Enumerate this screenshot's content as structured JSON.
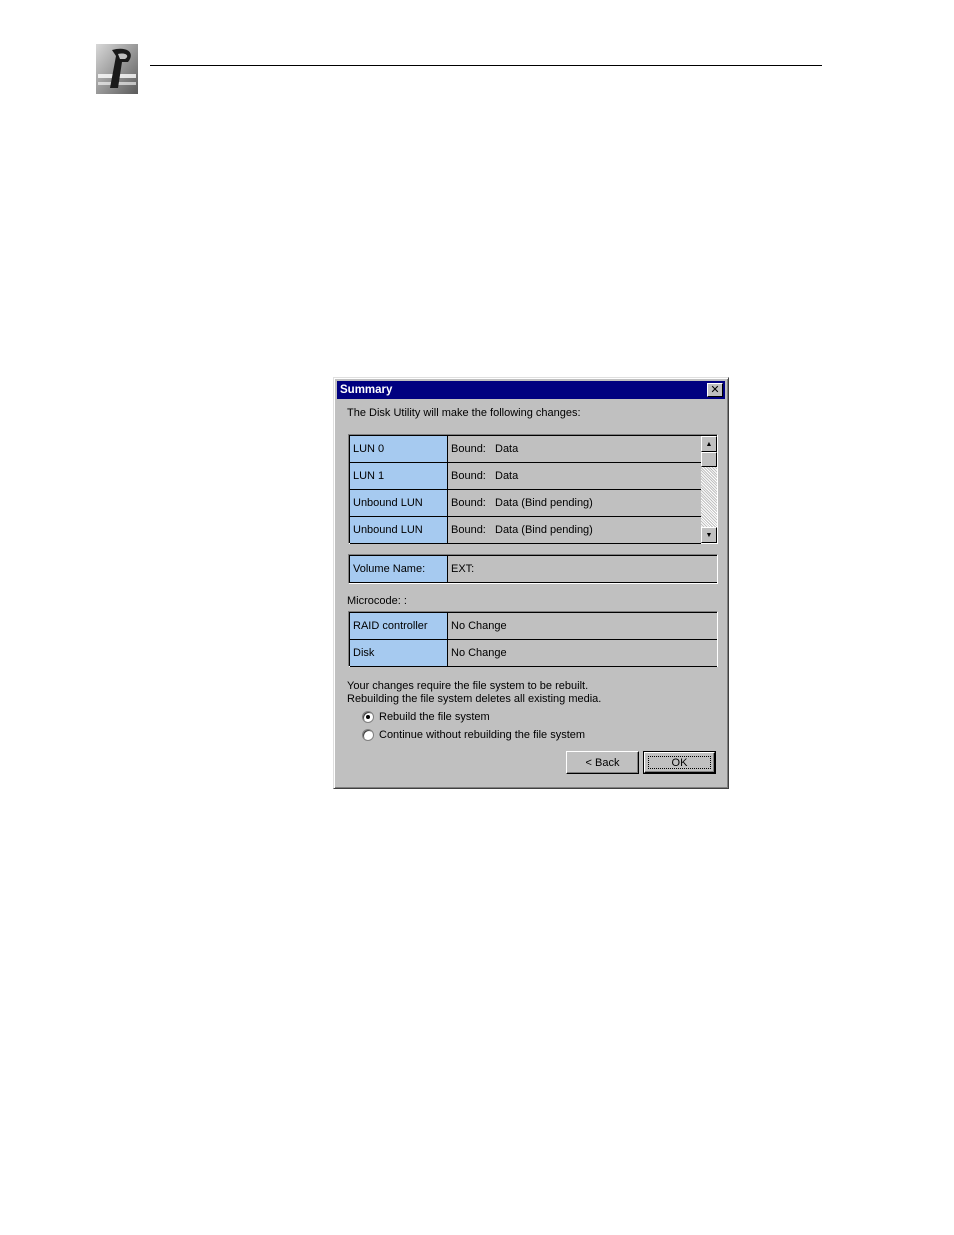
{
  "dialog": {
    "title": "Summary",
    "close_glyph": "✕",
    "intro": "The Disk Utility will make the following changes:",
    "lun_rows": [
      {
        "label": "LUN 0",
        "key": "Bound:",
        "value": "Data"
      },
      {
        "label": "LUN 1",
        "key": "Bound:",
        "value": "Data"
      },
      {
        "label": "Unbound LUN",
        "key": "Bound:",
        "value": "Data (Bind pending)"
      },
      {
        "label": "Unbound LUN",
        "key": "Bound:",
        "value": "Data (Bind pending)"
      }
    ],
    "volume": {
      "label": "Volume Name:",
      "value": "EXT:"
    },
    "microcode_heading": "Microcode: :",
    "microcode_rows": [
      {
        "label": "RAID controller",
        "value": "No Change"
      },
      {
        "label": "Disk",
        "value": "No Change"
      }
    ],
    "warning_line1": "Your changes require the file system to be rebuilt.",
    "warning_line2": "Rebuilding the file system deletes all existing media.",
    "radio_rebuild": "Rebuild the file system",
    "radio_continue": "Continue without rebuilding the file system",
    "back_label": "< Back",
    "ok_label": "OK"
  },
  "colors": {
    "titlebar": "#000080",
    "label_cell": "#a6caf0",
    "dialog_face": "#c0c0c0"
  },
  "icons": {
    "logo": "company-logo-icon",
    "scroll_up": "scroll-up-arrow-icon",
    "scroll_down": "scroll-down-arrow-icon"
  }
}
